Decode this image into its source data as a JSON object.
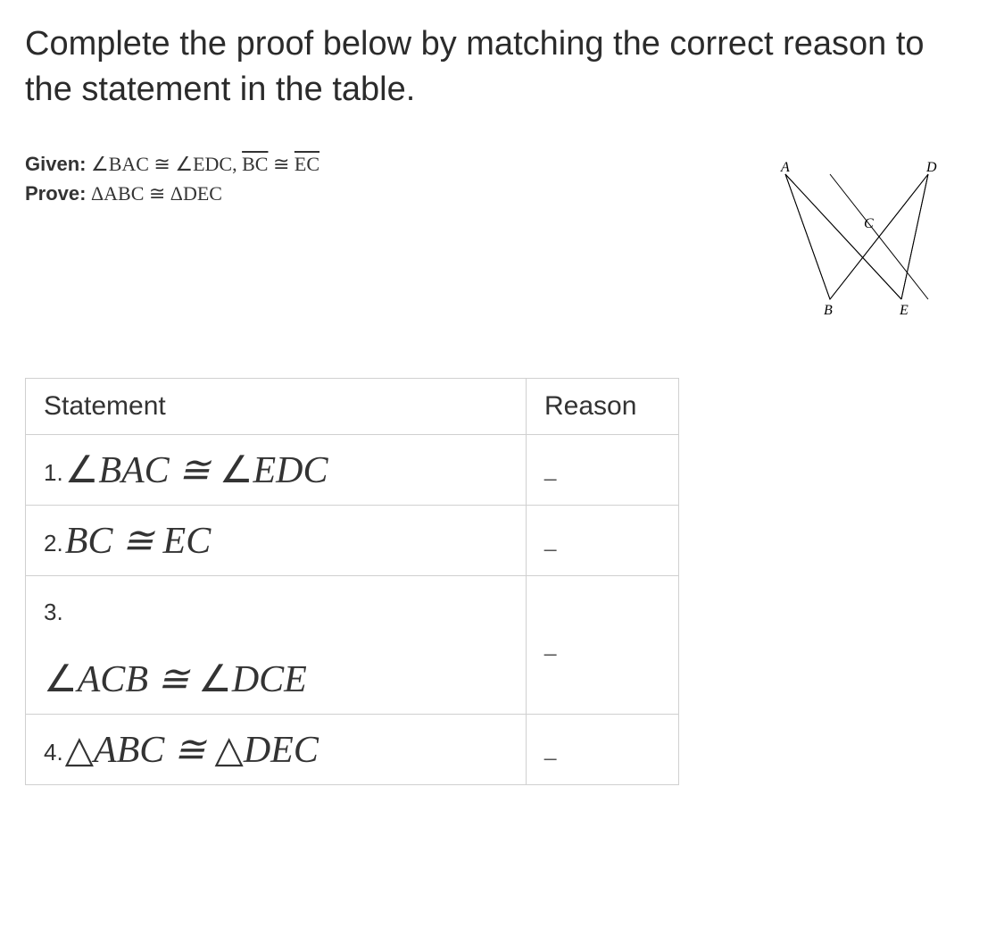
{
  "intro": "Complete the proof below by matching the correct reason to the statement in the table.",
  "given_label": "Given:",
  "given_text_1": "∠BAC ≅ ∠EDC,",
  "given_text_2": "BC",
  "given_text_3": "≅",
  "given_text_4": "EC",
  "prove_label": "Prove:",
  "prove_text": "ΔABC ≅ ΔDEC",
  "diagram": {
    "A": "A",
    "B": "B",
    "C": "C",
    "D": "D",
    "E": "E"
  },
  "table": {
    "header_statement": "Statement",
    "header_reason": "Reason",
    "rows": [
      {
        "num": "1.",
        "stmt_pre": "∠",
        "stmt_mid": "BAC ≅ ",
        "stmt_pre2": "∠",
        "stmt_end": "EDC",
        "reason": "_"
      },
      {
        "num": "2.",
        "stmt": "BC ≅ EC",
        "reason": "_"
      },
      {
        "num": "3.",
        "stmt_pre": "∠",
        "stmt_mid": "ACB ≅ ",
        "stmt_pre2": "∠",
        "stmt_end": "DCE",
        "reason": "_"
      },
      {
        "num": "4.",
        "stmt_pre": "△",
        "stmt_mid": "ABC ≅ ",
        "stmt_pre2": "△",
        "stmt_end": "DEC",
        "reason": "_"
      }
    ]
  }
}
